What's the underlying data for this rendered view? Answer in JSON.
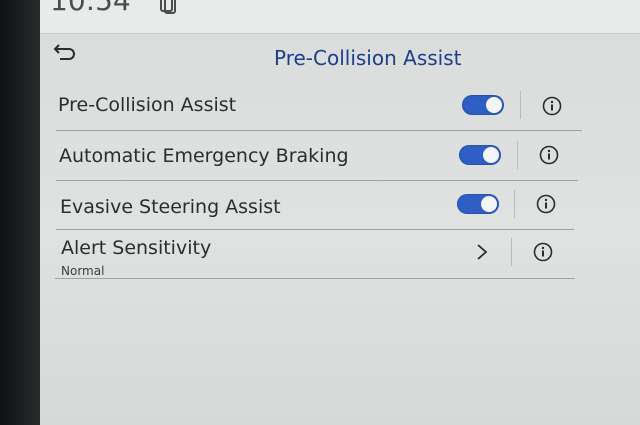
{
  "status": {
    "time": "10:54"
  },
  "header": {
    "title": "Pre-Collision Assist"
  },
  "settings": [
    {
      "label": "Pre-Collision Assist",
      "control": "toggle",
      "state": "on"
    },
    {
      "label": "Automatic Emergency Braking",
      "control": "toggle",
      "state": "on"
    },
    {
      "label": "Evasive Steering Assist",
      "control": "toggle",
      "state": "on"
    },
    {
      "label": "Alert Sensitivity",
      "value": "Normal",
      "control": "chevron"
    }
  ],
  "colors": {
    "accent": "#2d5fc4",
    "title": "#1f3d8a",
    "background": "#dfe2e1"
  },
  "icons": {
    "back": "back-arrow-icon",
    "info": "info-icon",
    "chevron": "chevron-right-icon",
    "phone": "phone-projection-icon"
  }
}
